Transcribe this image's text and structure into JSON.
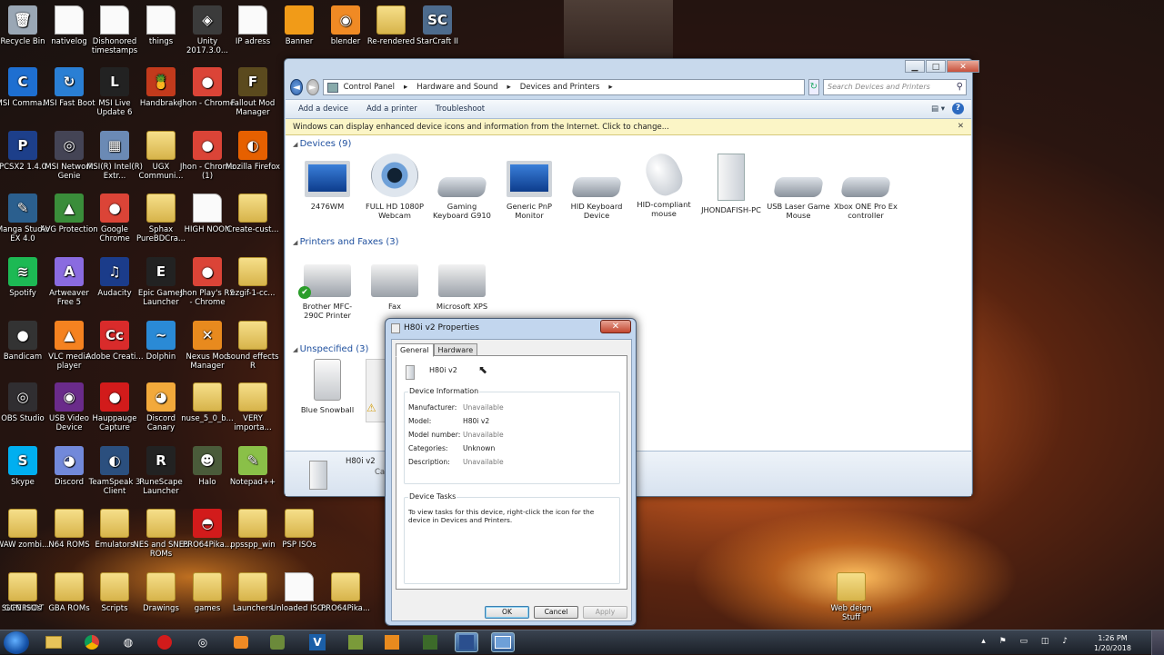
{
  "desktop_icons": [
    {
      "label": "Recycle Bin",
      "glyph": "🗑",
      "color": "#9aa7b5",
      "cls": ""
    },
    {
      "label": "nativelog",
      "glyph": "",
      "color": "#ffffff",
      "cls": "doc"
    },
    {
      "label": "Dishonored timestamps",
      "glyph": "",
      "color": "#ffffff",
      "cls": "doc"
    },
    {
      "label": "things",
      "glyph": "",
      "color": "#ffffff",
      "cls": "doc"
    },
    {
      "label": "Unity 2017.3.0...",
      "glyph": "◈",
      "color": "#3b3b3b",
      "cls": ""
    },
    {
      "label": "IP adress",
      "glyph": "",
      "color": "#ffffff",
      "cls": "doc"
    },
    {
      "label": "Banner",
      "glyph": "",
      "color": "#f19b18",
      "cls": ""
    },
    {
      "label": "blender",
      "glyph": "◉",
      "color": "#f08a24",
      "cls": ""
    },
    {
      "label": "Re-rendered",
      "glyph": "",
      "color": "#e6c35a",
      "cls": "folder"
    },
    {
      "label": "StarCraft II",
      "glyph": "SC",
      "color": "#4d6b8d",
      "cls": ""
    },
    {
      "label": "MSI Comma...",
      "glyph": "C",
      "color": "#1e6fd1",
      "cls": ""
    },
    {
      "label": "MSI Fast Boot",
      "glyph": "↻",
      "color": "#2a7fd4",
      "cls": ""
    },
    {
      "label": "MSI Live Update 6",
      "glyph": "L",
      "color": "#222",
      "cls": ""
    },
    {
      "label": "Handbrake",
      "glyph": "🍍",
      "color": "#c23a1c",
      "cls": ""
    },
    {
      "label": "Jhon - Chrome",
      "glyph": "●",
      "color": "#db4437",
      "cls": ""
    },
    {
      "label": "Fallout Mod Manager",
      "glyph": "F",
      "color": "#5b4a1e",
      "cls": ""
    },
    {
      "label": "PCSX2 1.4.0",
      "glyph": "P",
      "color": "#1d3f8a",
      "cls": ""
    },
    {
      "label": "MSI Network Genie",
      "glyph": "◎",
      "color": "#445",
      "cls": ""
    },
    {
      "label": "MSI(R) Intel(R) Extr...",
      "glyph": "▦",
      "color": "#6b8ab5",
      "cls": ""
    },
    {
      "label": "UGX Communi...",
      "glyph": "",
      "color": "#e6c35a",
      "cls": "folder"
    },
    {
      "label": "Jhon - Chrome (1)",
      "glyph": "●",
      "color": "#db4437",
      "cls": ""
    },
    {
      "label": "Mozilla Firefox",
      "glyph": "◐",
      "color": "#e66000",
      "cls": ""
    },
    {
      "label": "Manga Studio EX 4.0",
      "glyph": "✎",
      "color": "#2b5f8e",
      "cls": ""
    },
    {
      "label": "AVG Protection",
      "glyph": "▲",
      "color": "#3a8d3a",
      "cls": ""
    },
    {
      "label": "Google Chrome",
      "glyph": "●",
      "color": "#db4437",
      "cls": ""
    },
    {
      "label": "Sphax PureBDCra...",
      "glyph": "",
      "color": "#e6c35a",
      "cls": "folder"
    },
    {
      "label": "HIGH NOON",
      "glyph": "",
      "color": "#ffffff",
      "cls": "doc"
    },
    {
      "label": "Create-cust...",
      "glyph": "",
      "color": "#e6c35a",
      "cls": "folder"
    },
    {
      "label": "Spotify",
      "glyph": "≋",
      "color": "#1db954",
      "cls": ""
    },
    {
      "label": "Artweaver Free 5",
      "glyph": "A",
      "color": "#8a6be0",
      "cls": ""
    },
    {
      "label": "Audacity",
      "glyph": "♫",
      "color": "#1b3c8a",
      "cls": ""
    },
    {
      "label": "Epic Games Launcher",
      "glyph": "E",
      "color": "#222",
      "cls": ""
    },
    {
      "label": "Jhon Play's RS - Chrome",
      "glyph": "●",
      "color": "#db4437",
      "cls": ""
    },
    {
      "label": "ezgif-1-cc...",
      "glyph": "",
      "color": "#e6c35a",
      "cls": "folder"
    },
    {
      "label": "Bandicam",
      "glyph": "●",
      "color": "#333",
      "cls": ""
    },
    {
      "label": "VLC media player",
      "glyph": "▲",
      "color": "#f58220",
      "cls": ""
    },
    {
      "label": "Adobe Creati...",
      "glyph": "Cc",
      "color": "#d92b2b",
      "cls": ""
    },
    {
      "label": "Dolphin",
      "glyph": "~",
      "color": "#2a8ad6",
      "cls": ""
    },
    {
      "label": "Nexus Mod Manager",
      "glyph": "✕",
      "color": "#e88a1e",
      "cls": ""
    },
    {
      "label": "sound effects R",
      "glyph": "",
      "color": "#e6c35a",
      "cls": "folder"
    },
    {
      "label": "OBS Studio",
      "glyph": "◎",
      "color": "#302e31",
      "cls": ""
    },
    {
      "label": "USB Video Device",
      "glyph": "◉",
      "color": "#6a2b8a",
      "cls": ""
    },
    {
      "label": "Hauppauge Capture",
      "glyph": "●",
      "color": "#d21b1b",
      "cls": ""
    },
    {
      "label": "Discord Canary",
      "glyph": "◕",
      "color": "#f2a93b",
      "cls": ""
    },
    {
      "label": "nuse_5_0_b...",
      "glyph": "",
      "color": "#e6c35a",
      "cls": "folder"
    },
    {
      "label": "VERY importa...",
      "glyph": "",
      "color": "#e6c35a",
      "cls": "folder"
    },
    {
      "label": "Skype",
      "glyph": "S",
      "color": "#00aff0",
      "cls": ""
    },
    {
      "label": "Discord",
      "glyph": "◕",
      "color": "#7289da",
      "cls": ""
    },
    {
      "label": "TeamSpeak 3 Client",
      "glyph": "◐",
      "color": "#2b4f7e",
      "cls": ""
    },
    {
      "label": "RuneScape Launcher",
      "glyph": "R",
      "color": "#222",
      "cls": ""
    },
    {
      "label": "Halo",
      "glyph": "☻",
      "color": "#4a5b3a",
      "cls": ""
    },
    {
      "label": "Notepad++",
      "glyph": "✎",
      "color": "#8ac048",
      "cls": ""
    },
    {
      "label": "WAW zombi...",
      "glyph": "",
      "color": "#e6c35a",
      "cls": "folder"
    },
    {
      "label": "N64 ROMS",
      "glyph": "",
      "color": "#e6c35a",
      "cls": "folder"
    },
    {
      "label": "Emulators",
      "glyph": "",
      "color": "#e6c35a",
      "cls": "folder"
    },
    {
      "label": "NES and SNES ROMs",
      "glyph": "",
      "color": "#e6c35a",
      "cls": "folder"
    },
    {
      "label": "PRO64Pika...",
      "glyph": "◓",
      "color": "#d21b1b",
      "cls": ""
    },
    {
      "label": "ppsspp_win",
      "glyph": "",
      "color": "#e6c35a",
      "cls": "folder"
    },
    {
      "label": "PSP ISOs",
      "glyph": "",
      "color": "#e6c35a",
      "cls": "folder"
    },
    {
      "label": "SUPERHOT",
      "glyph": "☻",
      "color": "#c0281e",
      "cls": ""
    },
    {
      "label": "GBA ROMs",
      "glyph": "",
      "color": "#e6c35a",
      "cls": "folder"
    },
    {
      "label": "Scripts",
      "glyph": "",
      "color": "#e6c35a",
      "cls": "folder"
    },
    {
      "label": "Drawings",
      "glyph": "",
      "color": "#e6c35a",
      "cls": "folder"
    },
    {
      "label": "games",
      "glyph": "",
      "color": "#e6c35a",
      "cls": "folder"
    },
    {
      "label": "Launchers",
      "glyph": "",
      "color": "#e6c35a",
      "cls": "folder"
    },
    {
      "label": "Unloaded ISOs",
      "glyph": "",
      "color": "#ffffff",
      "cls": "doc"
    },
    {
      "label": "PRO64Pika...",
      "glyph": "",
      "color": "#e6c35a",
      "cls": "folder"
    },
    {
      "label": "GCN ISOs",
      "glyph": "",
      "color": "#e6c35a",
      "cls": "folder"
    },
    {
      "label": "Web deign Stuff",
      "glyph": "",
      "color": "#e6c35a",
      "cls": "folder"
    }
  ],
  "explorer": {
    "breadcrumb": [
      "Control Panel",
      "Hardware and Sound",
      "Devices and Printers"
    ],
    "search_placeholder": "Search Devices and Printers",
    "toolbar": {
      "add_device": "Add a device",
      "add_printer": "Add a printer",
      "troubleshoot": "Troubleshoot"
    },
    "info_bar": "Windows can display enhanced device icons and information from the Internet. Click to change...",
    "groups": {
      "devices": {
        "title": "Devices",
        "count": "(9)"
      },
      "printers": {
        "title": "Printers and Faxes",
        "count": "(3)"
      },
      "unspecified": {
        "title": "Unspecified",
        "count": "(3)"
      }
    },
    "devices": [
      {
        "label": "2476WM",
        "art": "monitor"
      },
      {
        "label": "FULL HD 1080P Webcam",
        "art": "cam"
      },
      {
        "label": "Gaming Keyboard G910",
        "art": "kbd"
      },
      {
        "label": "Generic PnP Monitor",
        "art": "monitor"
      },
      {
        "label": "HID Keyboard Device",
        "art": "kbd"
      },
      {
        "label": "HID-compliant mouse",
        "art": "mouse"
      },
      {
        "label": "JHONDAFISH-PC",
        "art": "pc"
      },
      {
        "label": "USB Laser Game Mouse",
        "art": "kbd"
      },
      {
        "label": "Xbox ONE Pro Ex controller",
        "art": "kbd"
      }
    ],
    "printers": [
      {
        "label": "Brother MFC-290C Printer",
        "art": "printer"
      },
      {
        "label": "Fax",
        "art": "printer"
      },
      {
        "label": "Microsoft XPS",
        "art": "printer"
      }
    ],
    "unspecified": [
      {
        "label": "Blue Snowball",
        "art": "snow"
      }
    ],
    "details_device": "H80i v2",
    "details_partial": "Ca"
  },
  "dialog": {
    "title": "H80i v2 Properties",
    "tabs": [
      "General",
      "Hardware"
    ],
    "device_name": "H80i v2",
    "info_legend": "Device Information",
    "info": [
      {
        "k": "Manufacturer:",
        "v": "Unavailable",
        "dark": false
      },
      {
        "k": "Model:",
        "v": "H80i v2",
        "dark": true
      },
      {
        "k": "Model number:",
        "v": "Unavailable",
        "dark": false
      },
      {
        "k": "Categories:",
        "v": "Unknown",
        "dark": true
      },
      {
        "k": "Description:",
        "v": "Unavailable",
        "dark": false
      }
    ],
    "tasks_legend": "Device Tasks",
    "tasks_text": "To view tasks for this device, right-click the icon for the device in Devices and Printers.",
    "ok": "OK",
    "cancel": "Cancel",
    "apply": "Apply"
  },
  "taskbar": {
    "time": "1:26 PM",
    "date": "1/20/2018"
  }
}
